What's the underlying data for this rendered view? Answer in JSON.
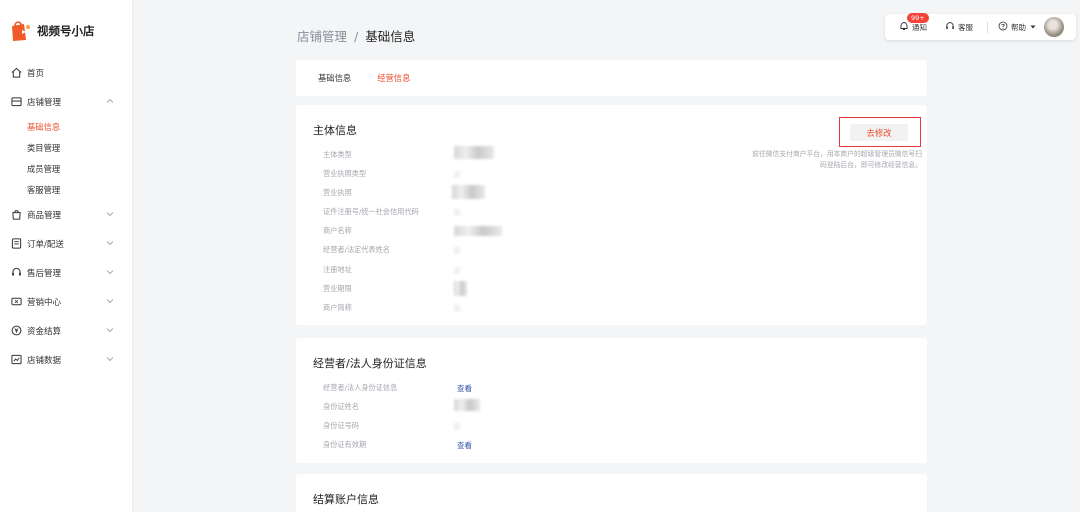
{
  "app": {
    "title": "视频号小店"
  },
  "nav": {
    "home": "首页",
    "store": "店铺管理",
    "store_sub": [
      "基础信息",
      "类目管理",
      "成员管理",
      "客服管理"
    ],
    "goods": "商品管理",
    "orders": "订单/配送",
    "aftersale": "售后管理",
    "marketing": "营销中心",
    "settlement": "资金结算",
    "data": "店铺数据"
  },
  "topbar": {
    "notify": "通知",
    "badge": "99+",
    "service": "客服",
    "help": "帮助"
  },
  "breadcrumb": {
    "parent": "店铺管理",
    "sep": "/",
    "current": "基础信息"
  },
  "tabs": [
    "基础信息",
    "经营信息"
  ],
  "subject": {
    "title": "主体信息",
    "modify": "去修改",
    "hint": "前往微信支付商户平台，用本商户的超级管理员微信号扫码登陆后台，即可修改经营信息。",
    "fields": [
      "主体类型",
      "营业执照类型",
      "营业执照",
      "证件注册号/统一社会信用代码",
      "商户名称",
      "经营者/法定代表姓名",
      "注册地址",
      "营业期限",
      "商户简称"
    ]
  },
  "legal": {
    "title": "经营者/法人身份证信息",
    "fields": [
      "经营者/法人身份证信息",
      "身份证姓名",
      "身份证号码",
      "身份证有效期"
    ],
    "view": "查看"
  },
  "settle": {
    "title": "结算账户信息"
  },
  "colors": {
    "accent": "#ee4d2d",
    "link": "#2f54a6",
    "highlight": "#e53935"
  }
}
